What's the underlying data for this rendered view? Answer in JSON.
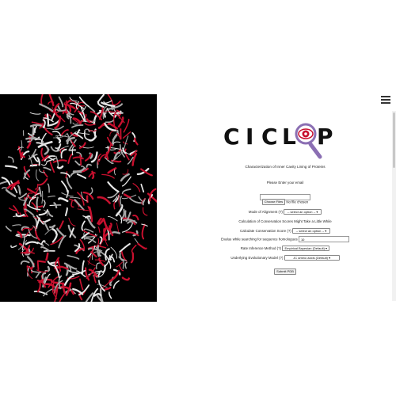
{
  "page": {
    "logo": {
      "letters": [
        "C",
        "I",
        "C",
        "L",
        "P"
      ],
      "alt_icon": "magnifier-eye-icon"
    },
    "subtitle": "Characterization of Inner Cavity Lining of Proteins",
    "email_prompt": "Please Enter your email",
    "email_value": "",
    "choose_files_label": "Choose Files",
    "no_file_text": "No file chosen",
    "alignment_label": "Mode of Alignment (?)",
    "alignment_value": "-- select an option --",
    "conservation_note": "Calculation of Conservation Scores Might Take a Little While",
    "conservation_label": "Calculate Conservation Score (?)",
    "conservation_value": "-- select an option --",
    "evalue_label": "Evalue while searching for sequence homologues",
    "evalue_value": "10",
    "rate_label": "Rate Inference Method (?)",
    "rate_value": "Empirical Bayesian (Default)",
    "model_label": "Underlying Evolutionary Model (?)",
    "model_value": "JC amino acids (Default)",
    "submit_label": "Submit PDB"
  },
  "ui": {
    "accent": "#c8102e",
    "magnifier_color": "#8b6fb3",
    "hero_bg": "#000000",
    "menu_icon": "hamburger-icon"
  }
}
